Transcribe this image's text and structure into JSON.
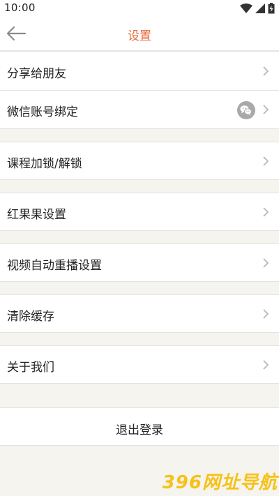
{
  "status_bar": {
    "time": "10:00"
  },
  "header": {
    "title": "设置",
    "back_icon": "arrow-left-icon"
  },
  "menu": {
    "share": "分享给朋友",
    "wechat": "微信账号绑定",
    "course_lock": "课程加锁/解锁",
    "red_fruit": "红果果设置",
    "autoplay": "视频自动重播设置",
    "clear_cache": "清除缓存",
    "about": "关于我们"
  },
  "logout": {
    "label": "退出登录"
  },
  "watermark": {
    "text": "396网址导航"
  },
  "colors": {
    "accent": "#e8673b",
    "background": "#f5f4ee",
    "row_background": "#ffffff",
    "divider": "#e2e2e2",
    "chevron": "#b8b8b8",
    "watermark": "#f6c21a"
  }
}
